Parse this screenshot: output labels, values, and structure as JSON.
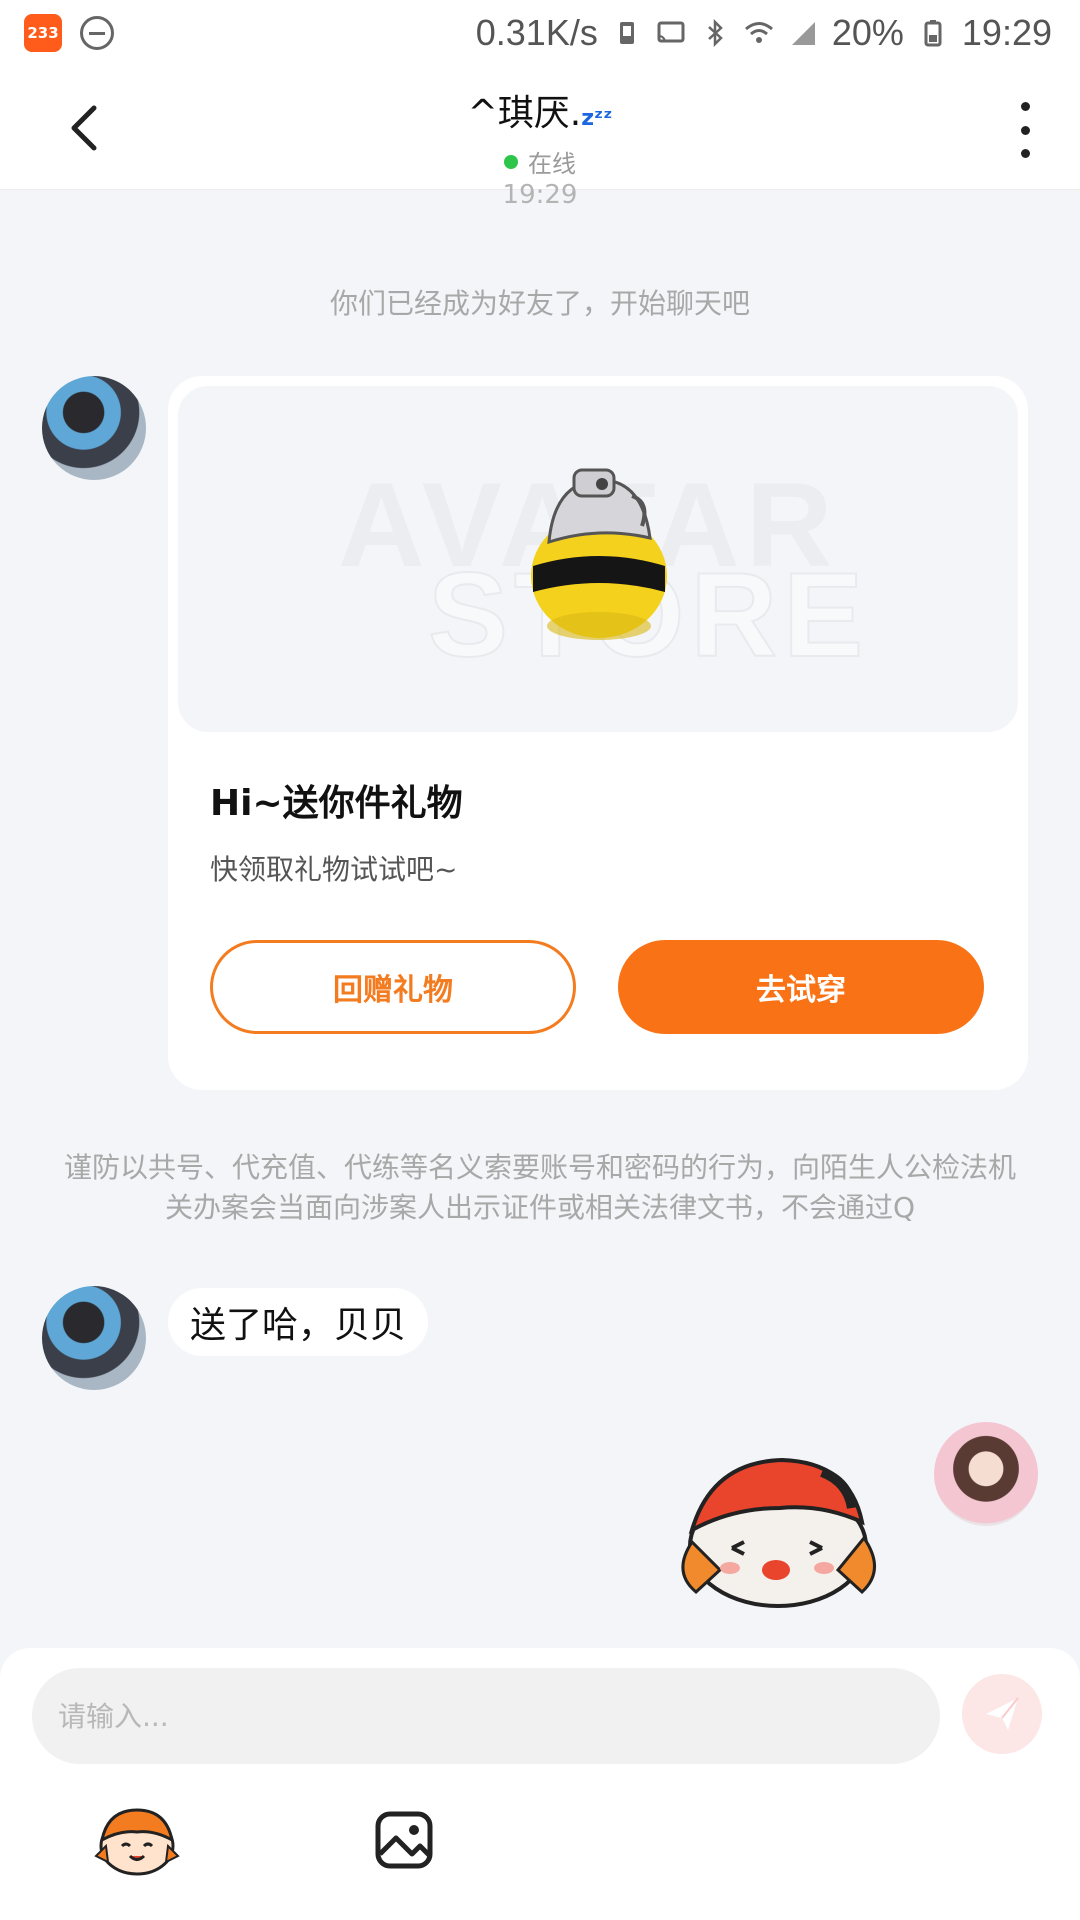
{
  "status_bar": {
    "app_badge": "233",
    "network_speed": "0.31K/s",
    "battery": "20%",
    "time": "19:29"
  },
  "header": {
    "title": "^琪厌.",
    "title_suffix": "zᶻᶻ",
    "status": "在线"
  },
  "chat": {
    "time_peek": "19:29",
    "system_message": "你们已经成为好友了，开始聊天吧",
    "gift_card": {
      "watermark_line1": "AVATAR",
      "watermark_line2": "STORE",
      "title": "Hi~送你件礼物",
      "subtitle": "快领取礼物试试吧~",
      "return_gift_label": "回赠礼物",
      "try_on_label": "去试穿"
    },
    "warning_message": "谨防以共号、代充值、代练等名义索要账号和密码的行为，向陌生人公检法机关办案会当面向涉案人出示证件或相关法律文书，不会通过Q",
    "text_message": "送了哈，贝贝"
  },
  "composer": {
    "placeholder": "请输入...",
    "value": ""
  },
  "colors": {
    "accent": "#f97316",
    "online": "#2ec54b",
    "send_button_bg": "#fde6e6"
  }
}
